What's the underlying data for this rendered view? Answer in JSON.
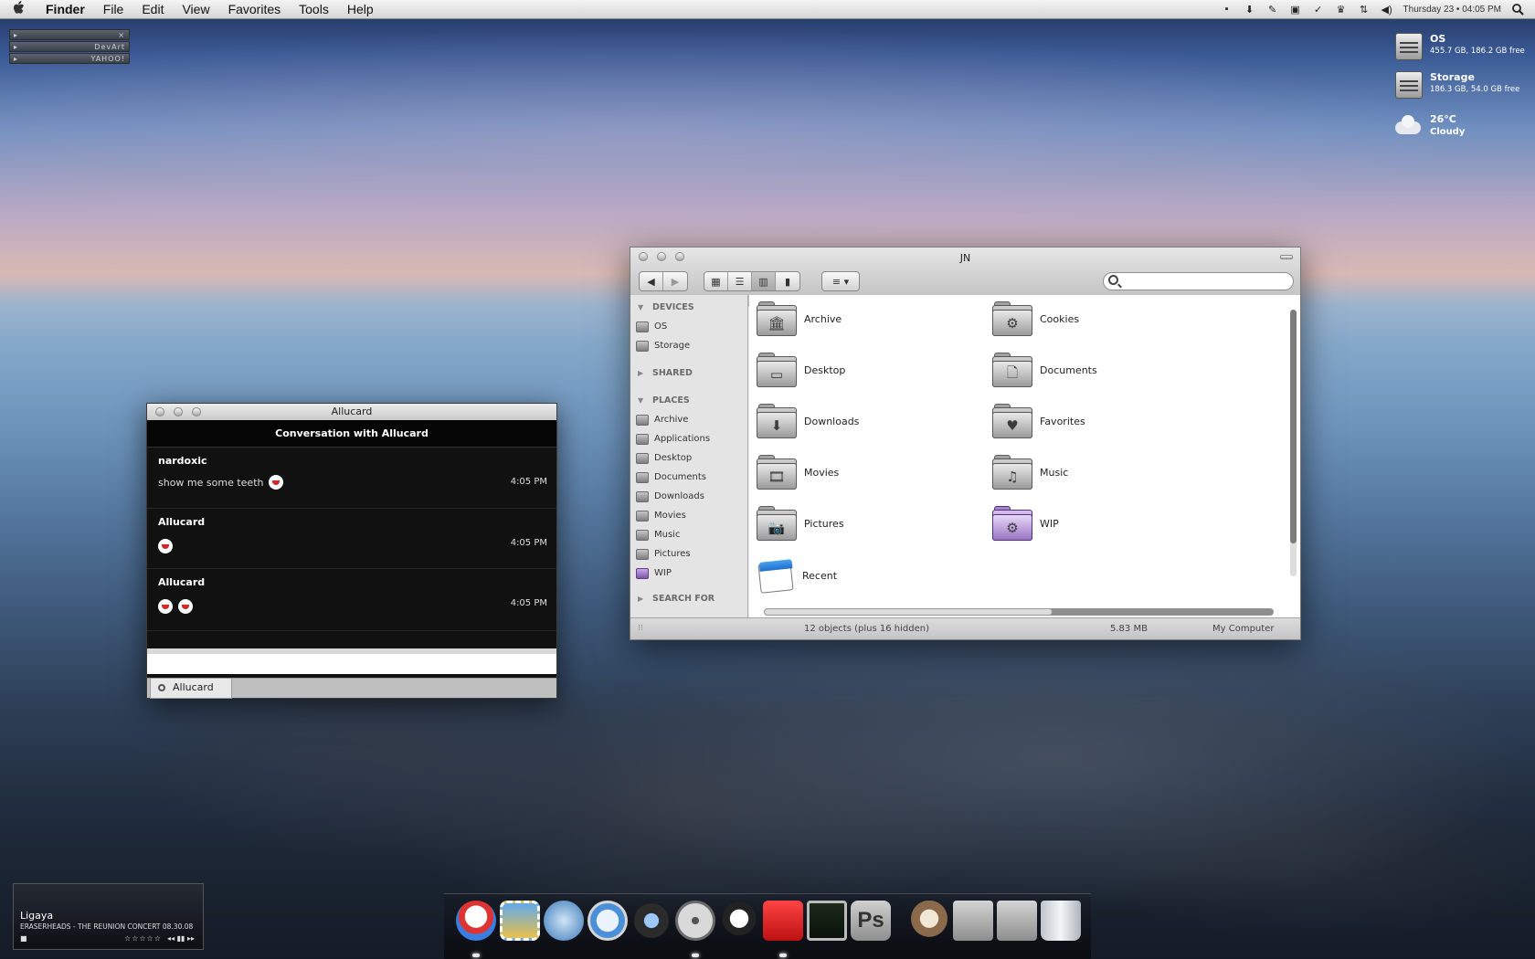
{
  "menubar": {
    "apple": "",
    "items": [
      "Finder",
      "File",
      "Edit",
      "View",
      "Favorites",
      "Tools",
      "Help"
    ],
    "extras": [
      "chat-bubble-icon",
      "download-arrow-icon",
      "pencil-icon",
      "gamepad-icon",
      "checkmark-icon",
      "crown-icon",
      "sync-arrows-icon",
      "volume-icon"
    ],
    "clock": "Thursday 23 • 04:05 PM",
    "search_icon": "spotlight-icon"
  },
  "bookmarks_widget": {
    "rows": [
      "",
      "DevArt",
      "YAHOO!"
    ]
  },
  "drives": [
    {
      "name": "OS",
      "info": "455.7 GB, 186.2 GB free"
    },
    {
      "name": "Storage",
      "info": "186.3 GB, 54.0 GB free"
    }
  ],
  "weather": {
    "temp": "26°C",
    "condition": "Cloudy"
  },
  "chat": {
    "window_title": "Allucard",
    "header": "Conversation with Allucard",
    "messages": [
      {
        "sender": "nardoxic",
        "text": "show me some teeth",
        "time": "4:05 PM",
        "emoticons": 1
      },
      {
        "sender": "Allucard",
        "text": "",
        "time": "4:05 PM",
        "emoticons": 1
      },
      {
        "sender": "Allucard",
        "text": "",
        "time": "4:05 PM",
        "emoticons": 2
      }
    ],
    "input_value": "",
    "tab_label": "Allucard"
  },
  "finder": {
    "title": "JN",
    "search_placeholder": "",
    "nav": {
      "back": "◀",
      "forward": "▶"
    },
    "view_buttons": [
      "icon-view-icon",
      "list-view-icon",
      "column-view-icon",
      "coverflow-view-icon"
    ],
    "action_button": "arrange-menu-icon",
    "sidebar": {
      "devices_header": "DEVICES",
      "devices": [
        "OS",
        "Storage"
      ],
      "shared_header": "SHARED",
      "places_header": "PLACES",
      "places": [
        "Archive",
        "Applications",
        "Desktop",
        "Documents",
        "Downloads",
        "Movies",
        "Music",
        "Pictures",
        "WIP"
      ],
      "search_header": "SEARCH FOR"
    },
    "items": [
      {
        "label": "Archive",
        "icon": "archive-folder-icon",
        "glyph": "🏛"
      },
      {
        "label": "Cookies",
        "icon": "cookies-folder-icon",
        "glyph": "⚙"
      },
      {
        "label": "Desktop",
        "icon": "desktop-folder-icon",
        "glyph": "▭"
      },
      {
        "label": "Documents",
        "icon": "documents-folder-icon",
        "glyph": "🗋"
      },
      {
        "label": "Downloads",
        "icon": "downloads-folder-icon",
        "glyph": "⬇"
      },
      {
        "label": "Favorites",
        "icon": "favorites-folder-icon",
        "glyph": "♥"
      },
      {
        "label": "Movies",
        "icon": "movies-folder-icon",
        "glyph": "🎞"
      },
      {
        "label": "Music",
        "icon": "music-folder-icon",
        "glyph": "♫"
      },
      {
        "label": "Pictures",
        "icon": "pictures-folder-icon",
        "glyph": "📷"
      },
      {
        "label": "WIP",
        "icon": "wip-folder-icon",
        "glyph": "⚙"
      },
      {
        "label": "Recent",
        "icon": "recent-items-icon",
        "glyph": ""
      }
    ],
    "status": {
      "count": "12 objects (plus 16 hidden)",
      "size": "5.83 MB",
      "location": "My Computer"
    }
  },
  "dock": {
    "apps": [
      "adium-icon",
      "mail-stamp-icon",
      "network-globe-icon",
      "safari-compass-icon",
      "itunes-headphones-icon",
      "dvd-player-icon",
      "kung-fu-panda-icon",
      "transmit-truck-icon",
      "activity-monitor-icon",
      "photoshop-icon",
      "owl-icon",
      "applications-stack-icon",
      "downloads-stack-icon",
      "trash-icon"
    ]
  },
  "music_widget": {
    "track": "Ligaya",
    "info": "ERASERHEADS - THE REUNION CONCERT 08.30.08",
    "rating": "☆☆☆☆☆",
    "controls": "◂◂ ▮▮ ▸▸"
  }
}
